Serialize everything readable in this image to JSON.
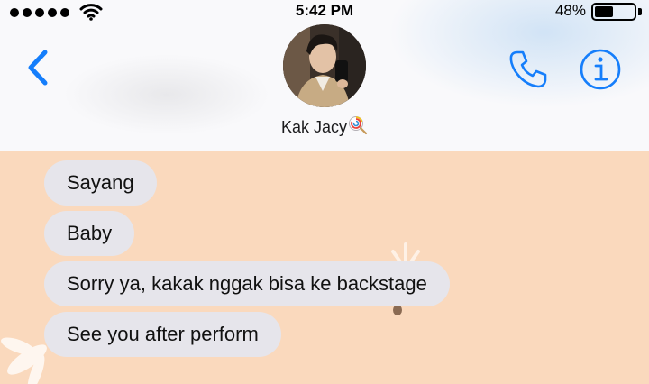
{
  "status_bar": {
    "time": "5:42 PM",
    "battery_percent_label": "48%",
    "battery_level": 0.48,
    "signal_bars": 5
  },
  "header": {
    "back_icon": "chevron-left-icon",
    "contact_name": "Kak Jacy",
    "contact_emoji": "lollipop-icon",
    "call_icon": "phone-icon",
    "info_icon": "info-icon",
    "accent_color": "#157efb"
  },
  "messages": [
    {
      "text": "Sayang",
      "direction": "incoming"
    },
    {
      "text": "Baby",
      "direction": "incoming"
    },
    {
      "text": "Sorry ya, kakak nggak bisa ke backstage",
      "direction": "incoming"
    },
    {
      "text": "See you after perform",
      "direction": "incoming"
    }
  ],
  "colors": {
    "chat_background": "#fad9bd",
    "bubble_incoming": "#e6e5eb",
    "header_background": "#f9f9fb"
  }
}
